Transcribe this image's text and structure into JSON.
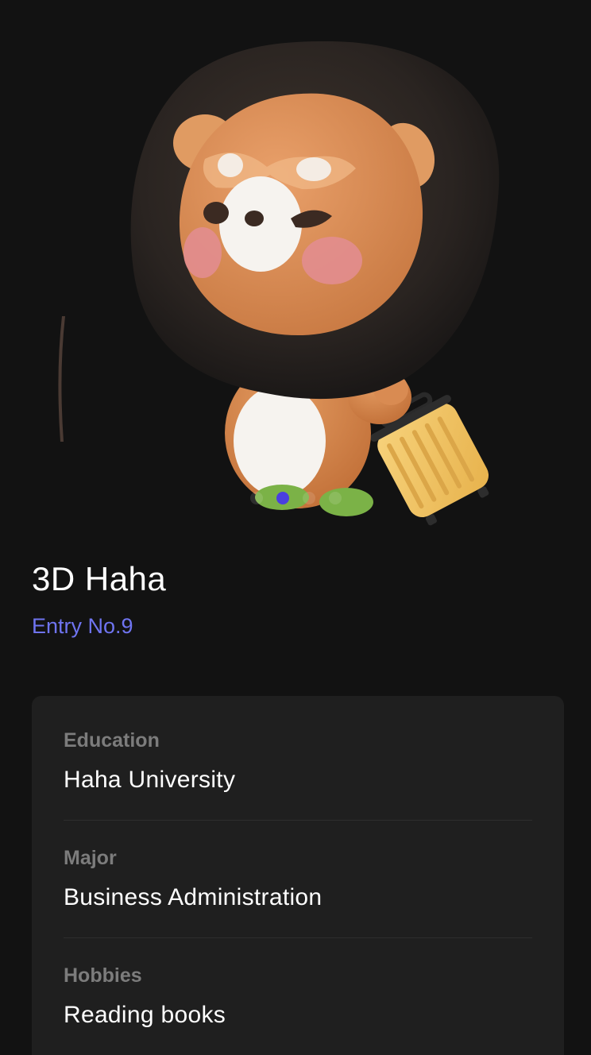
{
  "profile": {
    "name": "3D Haha",
    "entry": "Entry No.9"
  },
  "carousel": {
    "image": "3d-lion-character-with-suitcase",
    "active_index": 1,
    "dot_count": 4,
    "active_color": "#4a3fe0"
  },
  "details": [
    {
      "label": "Education",
      "value": "Haha University"
    },
    {
      "label": "Major",
      "value": "Business Administration"
    },
    {
      "label": "Hobbies",
      "value": "Reading books"
    }
  ],
  "colors": {
    "background": "#121212",
    "card": "#1f1f1f",
    "accent": "#6f74f0"
  }
}
